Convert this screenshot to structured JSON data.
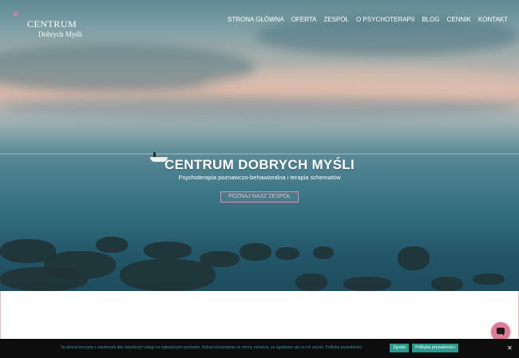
{
  "logo": {
    "line1": "CENTRUM",
    "line2": "Dobrych Myśli",
    "accent_color": "#e783a7"
  },
  "nav": {
    "items": [
      {
        "label": "STRONA GŁÓWNA"
      },
      {
        "label": "OFERTA"
      },
      {
        "label": "ZESPÓŁ"
      },
      {
        "label": "O PSYCHOTERAPII"
      },
      {
        "label": "BLOG"
      },
      {
        "label": "CENNIK"
      },
      {
        "label": "KONTAKT"
      }
    ]
  },
  "hero": {
    "title": "CENTRUM DOBRYCH MYŚLI",
    "subtitle": "Psychoterapia poznawczo-behawioralna i terapia schematów",
    "cta_label": "POZNAJ NASZ ZESPÓŁ"
  },
  "cookie_bar": {
    "text": "Ta strona korzysta z ciasteczek aby świadczyć usługi na najwyższym poziomie. Dalsze korzystanie ze strony oznacza, że zgadzasz się na ich użycie.",
    "link_label": "Polityka prywatności",
    "accept_label": "Zgoda",
    "policy_label": "Polityka prywatności",
    "close_icon": "close-icon"
  },
  "chat": {
    "icon": "chat-bubble-icon",
    "color": "#dc7c94"
  },
  "colors": {
    "accent_pink": "#e48aa8",
    "cookie_button": "#2a9a8e",
    "cookie_bg": "#0d0d0d"
  }
}
